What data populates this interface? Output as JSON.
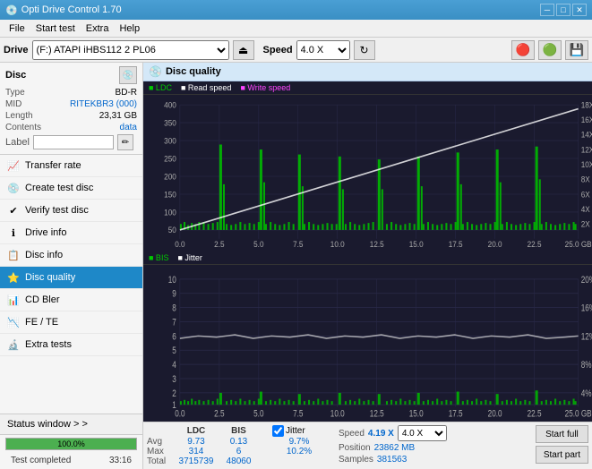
{
  "window": {
    "title": "Opti Drive Control 1.70",
    "icon": "💿",
    "min_btn": "─",
    "max_btn": "□",
    "close_btn": "✕"
  },
  "menubar": {
    "items": [
      "File",
      "Start test",
      "Extra",
      "Help"
    ]
  },
  "drive_toolbar": {
    "label": "Drive",
    "drive_value": "(F:)  ATAPI iHBS112  2 PL06",
    "eject_icon": "⏏",
    "speed_label": "Speed",
    "speed_value": "4.0 X",
    "refresh_icon": "↻",
    "icons": [
      "🔴",
      "🟢",
      "💾"
    ]
  },
  "disc": {
    "title": "Disc",
    "type_label": "Type",
    "type_value": "BD-R",
    "mid_label": "MID",
    "mid_value": "RITEKBR3 (000)",
    "length_label": "Length",
    "length_value": "23,31 GB",
    "contents_label": "Contents",
    "contents_value": "data",
    "label_label": "Label",
    "label_value": ""
  },
  "nav": {
    "items": [
      {
        "id": "transfer-rate",
        "label": "Transfer rate",
        "icon": "📈"
      },
      {
        "id": "create-test-disc",
        "label": "Create test disc",
        "icon": "💿"
      },
      {
        "id": "verify-test-disc",
        "label": "Verify test disc",
        "icon": "✔"
      },
      {
        "id": "drive-info",
        "label": "Drive info",
        "icon": "ℹ"
      },
      {
        "id": "disc-info",
        "label": "Disc info",
        "icon": "📋"
      },
      {
        "id": "disc-quality",
        "label": "Disc quality",
        "icon": "⭐",
        "active": true
      },
      {
        "id": "cd-bler",
        "label": "CD Bler",
        "icon": "📊"
      },
      {
        "id": "fe-te",
        "label": "FE / TE",
        "icon": "📉"
      },
      {
        "id": "extra-tests",
        "label": "Extra tests",
        "icon": "🔬"
      }
    ]
  },
  "status": {
    "window_label": "Status window > >",
    "progress_value": 100,
    "progress_text": "100.0%",
    "status_text": "Test completed",
    "time": "33:16"
  },
  "chart_panel": {
    "title": "Disc quality",
    "icon": "💿"
  },
  "charts": {
    "top": {
      "title": "LDC",
      "legend": [
        {
          "label": "LDC",
          "color": "#00cc00"
        },
        {
          "label": "Read speed",
          "color": "#ffffff"
        },
        {
          "label": "Write speed",
          "color": "#ff00ff"
        }
      ],
      "y_max": 400,
      "y_labels": [
        "400",
        "350",
        "300",
        "250",
        "200",
        "150",
        "100",
        "50"
      ],
      "y_right_labels": [
        "18X",
        "16X",
        "14X",
        "12X",
        "10X",
        "8X",
        "6X",
        "4X",
        "2X"
      ],
      "x_labels": [
        "0.0",
        "2.5",
        "5.0",
        "7.5",
        "10.0",
        "12.5",
        "15.0",
        "17.5",
        "20.0",
        "22.5",
        "25.0 GB"
      ]
    },
    "bottom": {
      "title": "BIS",
      "legend": [
        {
          "label": "BIS",
          "color": "#00cc00"
        },
        {
          "label": "Jitter",
          "color": "#ffffff"
        }
      ],
      "y_max": 10,
      "y_labels": [
        "10",
        "9",
        "8",
        "7",
        "6",
        "5",
        "4",
        "3",
        "2",
        "1"
      ],
      "y_right_labels": [
        "20%",
        "16%",
        "12%",
        "8%",
        "4%"
      ],
      "x_labels": [
        "0.0",
        "2.5",
        "5.0",
        "7.5",
        "10.0",
        "12.5",
        "15.0",
        "17.5",
        "20.0",
        "22.5",
        "25.0 GB"
      ]
    }
  },
  "stats": {
    "columns": [
      "",
      "LDC",
      "BIS",
      "",
      "Jitter",
      "Speed",
      "",
      ""
    ],
    "avg_label": "Avg",
    "avg_ldc": "9.73",
    "avg_bis": "0.13",
    "avg_jitter": "9.7%",
    "max_label": "Max",
    "max_ldc": "314",
    "max_bis": "6",
    "max_jitter": "10.2%",
    "total_label": "Total",
    "total_ldc": "3715739",
    "total_bis": "48060",
    "jitter_checked": true,
    "jitter_label": "Jitter",
    "speed_label": "Speed",
    "speed_value": "4.19 X",
    "speed_select": "4.0 X",
    "position_label": "Position",
    "position_value": "23862 MB",
    "samples_label": "Samples",
    "samples_value": "381563",
    "start_full_btn": "Start full",
    "start_part_btn": "Start part"
  }
}
